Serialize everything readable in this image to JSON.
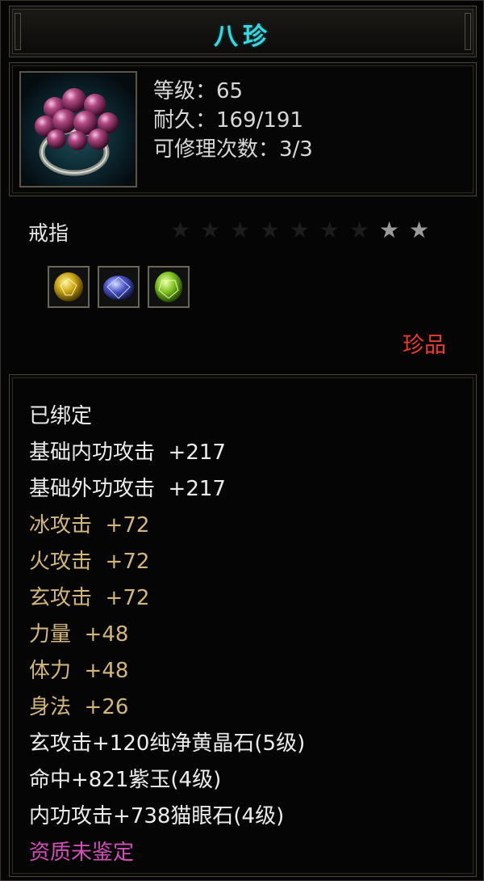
{
  "title": "八珍",
  "item": {
    "icon": "ring-icon",
    "stats": [
      "等级：65",
      "耐久：169/191",
      "可修理次数：3/3"
    ]
  },
  "type_label": "戒指",
  "stars": {
    "total": 9,
    "lit": 2
  },
  "gems": [
    "yellow-gem-icon",
    "blue-gem-icon",
    "green-gem-icon"
  ],
  "rarity": "珍品",
  "attributes": [
    {
      "text": "已绑定",
      "color": "white"
    },
    {
      "text": "基础内功攻击  +217",
      "color": "white"
    },
    {
      "text": "基础外功攻击  +217",
      "color": "white"
    },
    {
      "text": "冰攻击  +72",
      "color": "gold"
    },
    {
      "text": "火攻击  +72",
      "color": "gold"
    },
    {
      "text": "玄攻击  +72",
      "color": "gold"
    },
    {
      "text": "力量  +48",
      "color": "gold"
    },
    {
      "text": "体力  +48",
      "color": "gold"
    },
    {
      "text": "身法  +26",
      "color": "gold"
    },
    {
      "text": "玄攻击+120纯净黄晶石(5级)",
      "color": "white"
    },
    {
      "text": "命中+821紫玉(4级)",
      "color": "white"
    },
    {
      "text": "内功攻击+738猫眼石(4级)",
      "color": "white"
    },
    {
      "text": "资质未鉴定",
      "color": "purple"
    }
  ],
  "colors": {
    "title": "#38d8e2",
    "rarity": "#ea3b2e",
    "attr_white": "#ededed",
    "attr_gold": "#d3b77a",
    "attr_purple": "#d24fb8"
  }
}
